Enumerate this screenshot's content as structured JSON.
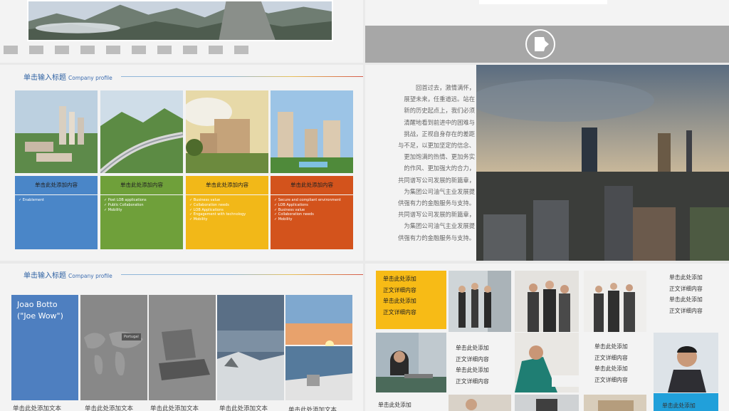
{
  "slide_top_left": {
    "thumb_count": 10
  },
  "slide_products": {
    "title": "单击输入标题",
    "title_en": "Company profile",
    "cards": [
      {
        "label": "单击此处添加内容",
        "color": "#4a86c8",
        "items": [
          "Enablement"
        ]
      },
      {
        "label": "单击此处添加内容",
        "color": "#6fa03a",
        "items": [
          "Post LOB applications",
          "Public Collaboration",
          "Mobility"
        ]
      },
      {
        "label": "单击此处添加内容",
        "color": "#f2b818",
        "items": [
          "Business value",
          "Collaboration needs",
          "LOB Applications",
          "Engagement with technology",
          "Mobility"
        ]
      },
      {
        "label": "单击此处添加内容",
        "color": "#d3531c",
        "items": [
          "Secure and compliant environment",
          "LOB Applications",
          "Business value",
          "Collaboration needs",
          "Mobility"
        ]
      }
    ]
  },
  "slide_profile": {
    "title": "单击输入标题",
    "title_en": "Company profile",
    "person_name": "Joao Botto",
    "person_nick": "(\"Joe Wow\")",
    "map_tag": "Portugal",
    "captions": [
      "单击此处添加文本",
      "单击此处添加文本",
      "单击此处添加文本",
      "单击此处添加文本",
      "单击此处添加文本"
    ]
  },
  "slide_city": {
    "paragraph": [
      "回首过去，激情满怀，",
      "展望未来，任重道远。站在",
      "新的历史起点上，我们必须",
      "清醒地看到前进中的困难与",
      "挑战，正视自身存在的差距",
      "与不足，以更加坚定的信念、",
      "更加饱满的热情、更加务实",
      "的作风、更加强大的合力，",
      "共同谱写公司发展的新篇章，",
      "为集团公司油气主业发展提",
      "供强有力的金融服务与支持。",
      "共同谱写公司发展的新篇章，",
      "为集团公司油气主业发展提",
      "供强有力的金融服务与支持。"
    ]
  },
  "slide_team": {
    "yellow_box": [
      "单击此处添加",
      "正文详细内容",
      "单击此处添加",
      "正文详细内容"
    ],
    "text_block_1": [
      "单击此处添加",
      "正文详细内容",
      "单击此处添加",
      "正文详细内容"
    ],
    "text_block_2": [
      "单击此处添加",
      "正文详细内容",
      "单击此处添加",
      "正文详细内容"
    ],
    "text_block_3": [
      "单击此处添加",
      "正文详细内容",
      "单击此处添加",
      "正文详细内容"
    ],
    "bottom_left": "单击此处添加",
    "bottom_right": "单击此处添加"
  }
}
